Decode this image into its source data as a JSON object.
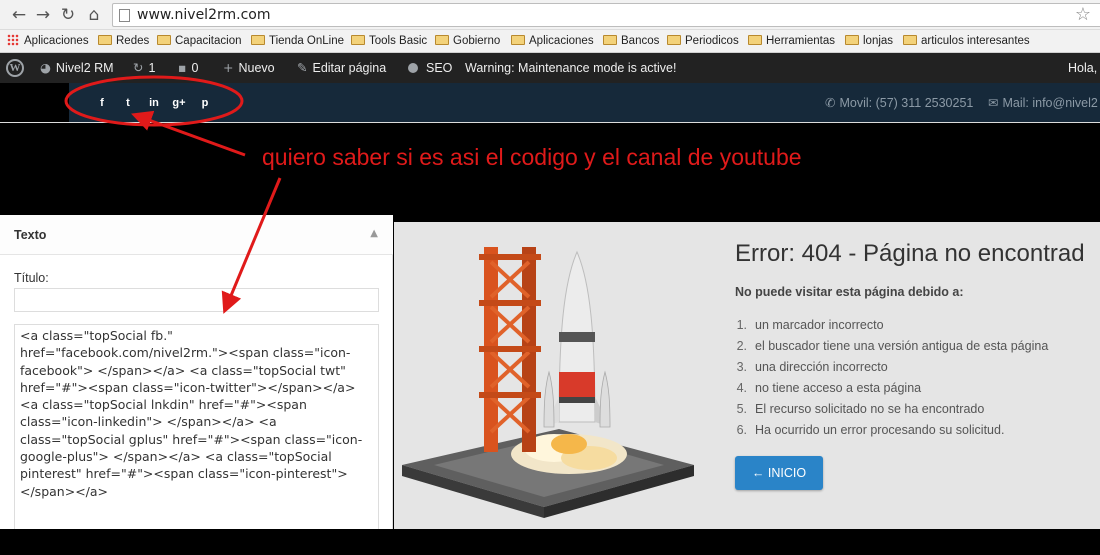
{
  "browser": {
    "url": "www.nivel2rm.com",
    "nav_icons": [
      "back-arrow-icon",
      "forward-arrow-icon",
      "reload-icon",
      "home-icon"
    ],
    "bookmarks": [
      {
        "label": "Aplicaciones",
        "icon": "apps-grid-icon"
      },
      {
        "label": "Redes",
        "icon": "folder-icon"
      },
      {
        "label": "Capacitacion",
        "icon": "folder-icon"
      },
      {
        "label": "Tienda OnLine",
        "icon": "folder-icon"
      },
      {
        "label": "Tools Basic",
        "icon": "folder-icon"
      },
      {
        "label": "Gobierno",
        "icon": "folder-icon"
      },
      {
        "label": "Aplicaciones",
        "icon": "folder-icon"
      },
      {
        "label": "Bancos",
        "icon": "folder-icon"
      },
      {
        "label": "Periodicos",
        "icon": "folder-icon"
      },
      {
        "label": "Herramientas",
        "icon": "folder-icon"
      },
      {
        "label": "lonjas",
        "icon": "folder-icon"
      },
      {
        "label": "articulos interesantes",
        "icon": "folder-icon"
      }
    ]
  },
  "adminbar": {
    "site_name": "Nivel2 RM",
    "updates_count": "1",
    "comments_count": "0",
    "new_label": "Nuevo",
    "edit_label": "Editar página",
    "seo_label": "SEO",
    "warning": "Warning: Maintenance mode is active!",
    "greeting": "Hola,"
  },
  "header": {
    "social_icons": [
      {
        "glyph": "f",
        "name": "facebook-icon"
      },
      {
        "glyph": "t",
        "name": "twitter-icon"
      },
      {
        "glyph": "in",
        "name": "linkedin-icon"
      },
      {
        "glyph": "g+",
        "name": "google-plus-icon"
      },
      {
        "glyph": "p",
        "name": "pinterest-icon"
      }
    ],
    "phone": "Movil: (57) 311 2530251",
    "mail": "Mail: info@nivel2"
  },
  "annotation": {
    "text": "quiero saber si es asi el codigo y el canal de youtube",
    "color": "#e01a1a"
  },
  "widget": {
    "title": "Texto",
    "field_label": "Título:",
    "title_value": "",
    "content": "<a class=\"topSocial fb.\" href=\"facebook.com/nivel2rm.\"><span class=\"icon-facebook\"> </span></a> <a class=\"topSocial twt\" href=\"#\"><span class=\"icon-twitter\"></span></a> <a class=\"topSocial lnkdin\" href=\"#\"><span class=\"icon-linkedin\"> </span></a> <a class=\"topSocial gplus\" href=\"#\"><span class=\"icon-google-plus\"> </span></a> <a class=\"topSocial pinterest\" href=\"#\"><span class=\"icon-pinterest\"> </span></a>"
  },
  "error_page": {
    "title": "Error: 404 - Página no encontrad",
    "subtitle": "No puede visitar esta página debido a:",
    "reasons": [
      {
        "num": "1.",
        "text": "un marcador incorrecto"
      },
      {
        "num": "2.",
        "text": "el buscador tiene una versión antigua de esta página"
      },
      {
        "num": "3.",
        "text": "una dirección incorrecto"
      },
      {
        "num": "4.",
        "text": "no tiene acceso a esta página"
      },
      {
        "num": "5.",
        "text": "El recurso solicitado no se ha encontrado"
      },
      {
        "num": "6.",
        "text": "Ha ocurrido un error procesando su solicitud."
      }
    ],
    "button_label": "← INICIO",
    "button_color": "#2a84c8"
  },
  "colors": {
    "header_bg": "#16293a",
    "adminbar_bg": "#222222"
  }
}
